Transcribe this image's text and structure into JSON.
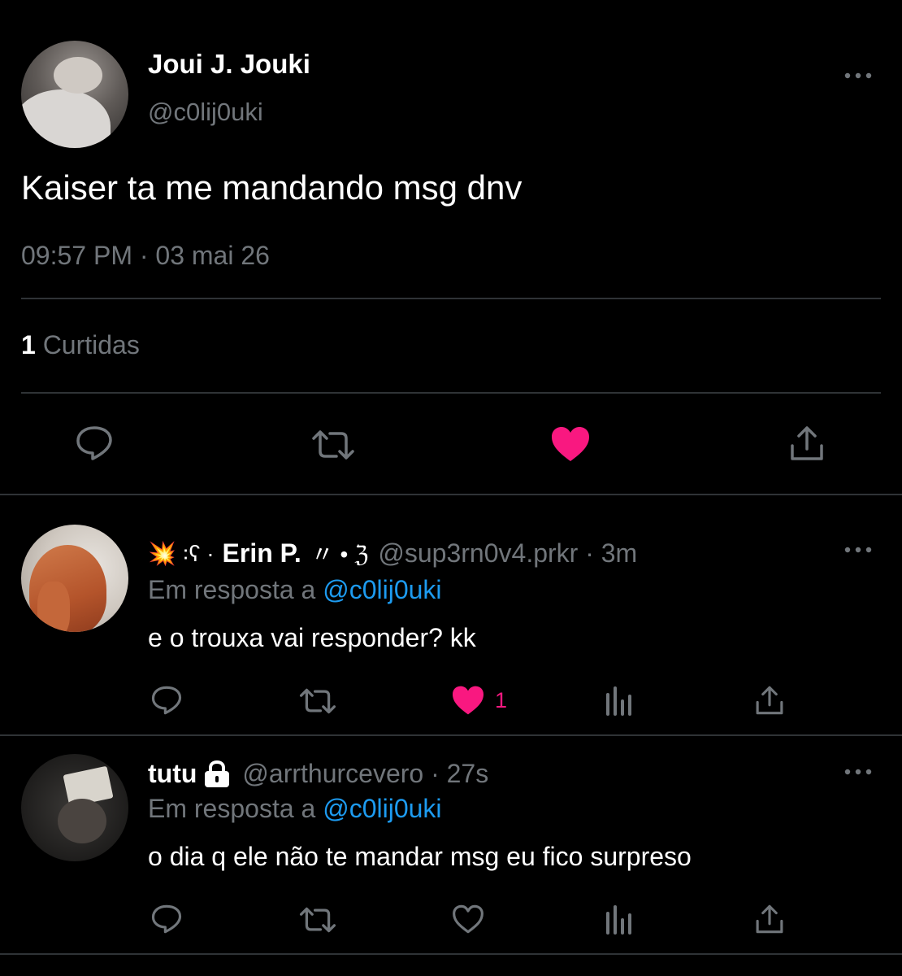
{
  "main_tweet": {
    "author_name": "Joui J. Jouki",
    "author_handle": "@c0lij0uki",
    "text": "Kaiser ta me mandando msg dnv",
    "timestamp": "09:57 PM · 03 mai 26",
    "likes_count": "1",
    "likes_label": "Curtidas",
    "liked": true
  },
  "replies": [
    {
      "name_prefix": "💥 ꞉ʕ ·",
      "name": "Erin P.",
      "name_suffix": "〃 • ℨ",
      "handle": "@sup3rn0v4.prkr",
      "time": "3m",
      "reply_to_label": "Em resposta a",
      "reply_to_handle": "@c0lij0uki",
      "text": "e o trouxa vai responder? kk",
      "like_count": "1",
      "liked": true
    },
    {
      "name": "tutu",
      "handle": "@arrthurcevero",
      "time": "27s",
      "reply_to_label": "Em resposta a",
      "reply_to_handle": "@c0lij0uki",
      "text": "o dia q ele não te mandar msg eu fico surpreso",
      "like_count": "",
      "liked": false,
      "protected": true
    }
  ],
  "icons": {
    "reply": "reply-icon",
    "retweet": "retweet-icon",
    "like": "heart-icon",
    "views": "views-icon",
    "share": "share-icon",
    "more": "more-icon",
    "lock": "lock-icon"
  },
  "colors": {
    "background": "#000000",
    "text_primary": "#ffffff",
    "text_secondary": "#71767b",
    "divider": "#2f3336",
    "like": "#f91880",
    "link": "#1d9bf0"
  }
}
